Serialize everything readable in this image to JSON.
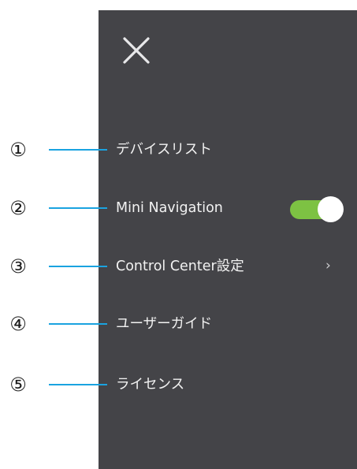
{
  "menu": {
    "items": [
      {
        "callout": "①",
        "label": "デバイスリスト"
      },
      {
        "callout": "②",
        "label": "Mini Navigation",
        "toggle_on": true
      },
      {
        "callout": "③",
        "label": "Control Center設定",
        "chevron": "›"
      },
      {
        "callout": "④",
        "label": "ユーザーガイド"
      },
      {
        "callout": "⑤",
        "label": "ライセンス"
      }
    ]
  },
  "icons": {
    "close": "close-icon",
    "chevron": "chevron-right-icon"
  },
  "colors": {
    "panel_bg": "#444448",
    "label_text": "#f2f2f2",
    "leader_line": "#1aa3e0",
    "toggle_on": "#7dc243"
  }
}
